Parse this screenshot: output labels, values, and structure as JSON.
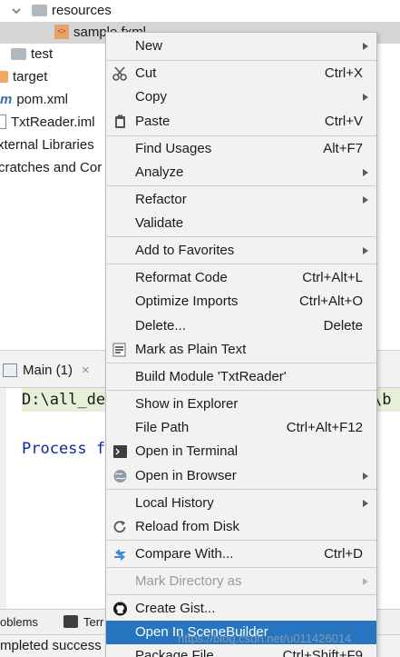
{
  "project_tree": {
    "items": [
      {
        "label": "resources",
        "icon": "folder-icon"
      },
      {
        "label": "sample.fxml",
        "icon": "fxml-file-icon"
      },
      {
        "label": "test",
        "icon": "folder-icon"
      },
      {
        "label": "target",
        "icon": "folder-icon"
      },
      {
        "label": "pom.xml",
        "icon": "maven-icon"
      },
      {
        "label": "TxtReader.iml",
        "icon": "file-icon"
      },
      {
        "label": "xternal Libraries",
        "icon": ""
      },
      {
        "label": "cratches and Cor",
        "icon": ""
      }
    ]
  },
  "run_panel": {
    "tab_label": "Main (1)",
    "close_glyph": "×",
    "command_line_start": "D:\\all_de",
    "command_line_end": "\\b",
    "process_text": "Process f"
  },
  "bottom_tabs": {
    "problems": "oblems",
    "terminal": "Terr"
  },
  "status_bar": {
    "text": "mpleted success"
  },
  "context_menu": {
    "items": [
      {
        "label": "New",
        "shortcut": "",
        "submenu": true
      },
      {
        "label": "Cut",
        "shortcut": "Ctrl+X",
        "icon": "scissors-icon"
      },
      {
        "label": "Copy",
        "shortcut": "",
        "submenu": true
      },
      {
        "label": "Paste",
        "shortcut": "Ctrl+V",
        "icon": "clipboard-icon"
      },
      {
        "label": "Find Usages",
        "shortcut": "Alt+F7"
      },
      {
        "label": "Analyze",
        "shortcut": "",
        "submenu": true
      },
      {
        "label": "Refactor",
        "shortcut": "",
        "submenu": true
      },
      {
        "label": "Validate",
        "shortcut": ""
      },
      {
        "label": "Add to Favorites",
        "shortcut": "",
        "submenu": true
      },
      {
        "label": "Reformat Code",
        "shortcut": "Ctrl+Alt+L"
      },
      {
        "label": "Optimize Imports",
        "shortcut": "Ctrl+Alt+O"
      },
      {
        "label": "Delete...",
        "shortcut": "Delete"
      },
      {
        "label": "Mark as Plain Text",
        "shortcut": "",
        "icon": "plain-text-icon"
      },
      {
        "label": "Build Module 'TxtReader'",
        "shortcut": ""
      },
      {
        "label": "Show in Explorer",
        "shortcut": ""
      },
      {
        "label": "File Path",
        "shortcut": "Ctrl+Alt+F12"
      },
      {
        "label": "Open in Terminal",
        "shortcut": "",
        "icon": "terminal-icon"
      },
      {
        "label": "Open in Browser",
        "shortcut": "",
        "submenu": true,
        "icon": "globe-icon"
      },
      {
        "label": "Local History",
        "shortcut": "",
        "submenu": true
      },
      {
        "label": "Reload from Disk",
        "shortcut": "",
        "icon": "reload-icon"
      },
      {
        "label": "Compare With...",
        "shortcut": "Ctrl+D",
        "icon": "compare-icon"
      },
      {
        "label": "Mark Directory as",
        "shortcut": "",
        "submenu": true,
        "disabled": true
      },
      {
        "label": "Create Gist...",
        "shortcut": "",
        "icon": "github-icon"
      },
      {
        "label": "Open In SceneBuilder",
        "shortcut": "",
        "active": true
      },
      {
        "label": "Package File",
        "shortcut": "Ctrl+Shift+F9"
      }
    ]
  },
  "watermark": "https://blog.csdn.net/u011426014",
  "colors": {
    "menu_background": "#f2f2f2",
    "active_item": "#2675bf",
    "disabled_text": "#9a9a9a",
    "console_command_bg": "#e6f0d9",
    "process_text": "#0b2a9a"
  }
}
